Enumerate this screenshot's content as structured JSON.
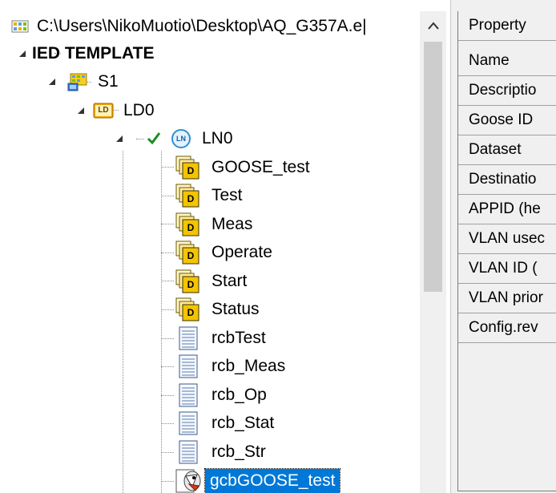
{
  "tree": {
    "path_title": "C:\\Users\\NikoMuotio\\Desktop\\AQ_G357A.e|",
    "nodes": {
      "ied": "IED TEMPLATE",
      "s1": "S1",
      "ld0": "LD0",
      "ln0": "LN0",
      "goose_test": "GOOSE_test",
      "test": "Test",
      "meas": "Meas",
      "operate": "Operate",
      "start": "Start",
      "status": "Status",
      "rcbtest": "rcbTest",
      "rcb_meas": "rcb_Meas",
      "rcb_op": "rcb_Op",
      "rcb_stat": "rcb_Stat",
      "rcb_str": "rcb_Str",
      "gcb": "gcbGOOSE_test"
    },
    "icon_text": {
      "ld": "LD",
      "ln": "LN",
      "d": "D"
    },
    "icons": {
      "expander": "triangle-expanded-icon",
      "checkbox": "checkbox-checked-icon",
      "dataset": "dataset-icon",
      "report": "report-control-icon",
      "goose": "goose-control-icon",
      "server": "server-icon"
    }
  },
  "properties": {
    "header": "Property",
    "rows": [
      "Name",
      "Descriptio",
      "Goose ID",
      "Dataset",
      "Destinatio",
      "APPID (he",
      "VLAN usec",
      "VLAN ID (",
      "VLAN prior",
      "Config.rev"
    ]
  },
  "colors": {
    "selection": "#0078d7",
    "check": "#1e8c1e",
    "ld_badge": "#f2a400",
    "ln_badge": "#2d8fd8"
  }
}
